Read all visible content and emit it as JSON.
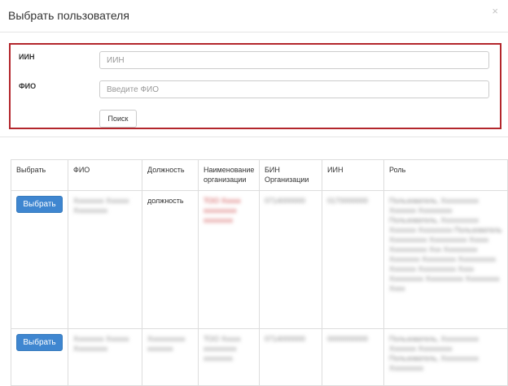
{
  "modal": {
    "title": "Выбрать пользователя",
    "close_glyph": "×"
  },
  "search": {
    "iin_label": "ИИН",
    "iin_placeholder": "ИИН",
    "fio_label": "ФИО",
    "fio_placeholder": "Введите ФИО",
    "search_button": "Поиск"
  },
  "table": {
    "headers": [
      "Выбрать",
      "ФИО",
      "Должность",
      "Наименование организации",
      "БИН Организации",
      "ИИН",
      "Роль"
    ],
    "rows": [
      {
        "select_label": "Выбрать",
        "fio": "Xxxxxxxx Xxxxxx Xxxxxxxxx",
        "position": "должность",
        "org": "ТОО Xxxxx xxxxxxxxx xxxxxxxx",
        "bin": "0714000000",
        "iin": "0170000000",
        "role": "Пользователь, Xxxxxxxxxx Xxxxxxx Xxxxxxxxx Пользователь, Xxxxxxxxxx Xxxxxxx Xxxxxxxxx Пользователь Xxxxxxxxxx Xxxxxxxxxx Xxxxx Xxxxxxxxxx Xxx Xxxxxxxxx Xxxxxxxx Xxxxxxxxx Xxxxxxxxxx Xxxxxxx Xxxxxxxxxx Xxxx Xxxxxxxxx Xxxxxxxxxx Xxxxxxxxx Xxxx"
      },
      {
        "select_label": "Выбрать",
        "fio": "Xxxxxxxx Xxxxxx Xxxxxxxxx",
        "position": "Xxxxxxxxxx xxxxxxx",
        "org": "ТОО Xxxxx xxxxxxxxx xxxxxxxx",
        "bin": "0714000000",
        "iin": "0000000000",
        "role": "Пользователь, Xxxxxxxxxx Xxxxxxx Xxxxxxxxx Пользователь, Xxxxxxxxxx Xxxxxxxxx"
      }
    ]
  }
}
